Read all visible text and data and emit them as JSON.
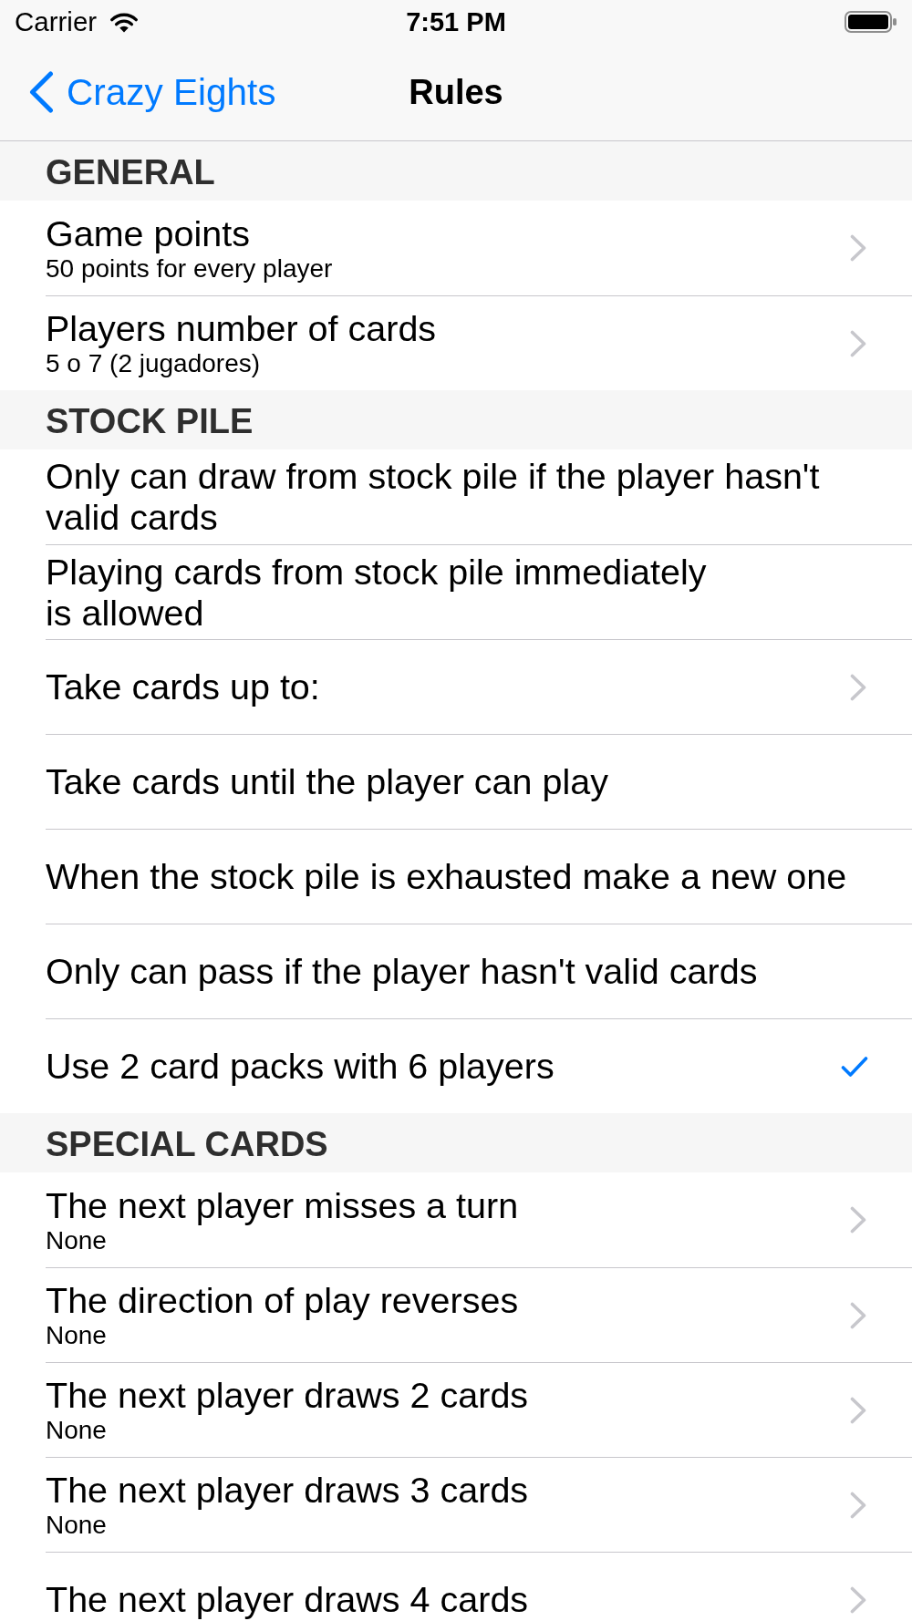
{
  "status_bar": {
    "carrier": "Carrier",
    "time": "7:51 PM"
  },
  "navigation_bar": {
    "back_button": "Crazy Eights",
    "title": "Rules"
  },
  "sections": [
    {
      "header": "GENERAL",
      "rows": [
        {
          "kind": "detail",
          "title": "Game points",
          "value": "50 points for every player"
        },
        {
          "kind": "detail",
          "title": "Players number of cards",
          "value": "5 o 7 (2 jugadores)"
        }
      ]
    },
    {
      "header": "STOCK PILE",
      "rows": [
        {
          "kind": "check",
          "title": "Only can draw from stock pile if the player hasn't valid cards",
          "checked": false
        },
        {
          "kind": "check",
          "title": "Playing cards from stock pile immediately\nis allowed",
          "checked": false
        },
        {
          "kind": "detail",
          "title": "Take cards up to:"
        },
        {
          "kind": "check",
          "title": "Take cards until the player can play",
          "checked": false
        },
        {
          "kind": "check",
          "title": "When the stock pile is exhausted make a new one",
          "checked": false
        },
        {
          "kind": "check",
          "title": "Only can pass if the player hasn't valid cards",
          "checked": false
        },
        {
          "kind": "check",
          "title": "Use 2 card packs with 6 players",
          "checked": true
        }
      ]
    },
    {
      "header": "SPECIAL CARDS",
      "rows": [
        {
          "kind": "detail",
          "title": "The next player misses a turn",
          "value": "None"
        },
        {
          "kind": "detail",
          "title": "The direction of play reverses",
          "value": "None"
        },
        {
          "kind": "detail",
          "title": "The next player draws 2 cards",
          "value": "None"
        },
        {
          "kind": "detail",
          "title": "The next player draws 3 cards",
          "value": "None"
        },
        {
          "kind": "detail",
          "title": "The next player draws 4 cards"
        }
      ]
    }
  ]
}
